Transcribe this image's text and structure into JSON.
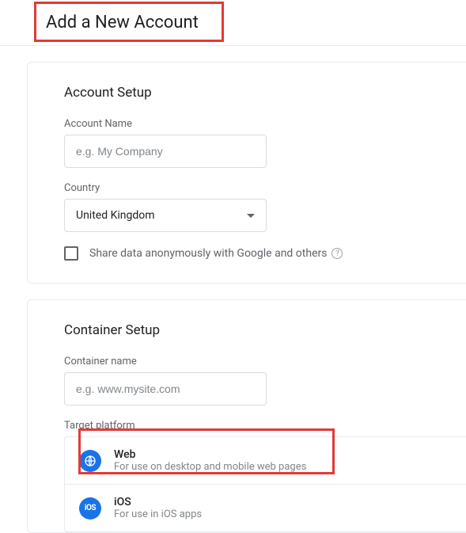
{
  "page": {
    "title": "Add a New Account"
  },
  "accountSetup": {
    "heading": "Account Setup",
    "nameLabel": "Account Name",
    "namePlaceholder": "e.g. My Company",
    "countryLabel": "Country",
    "countryValue": "United Kingdom",
    "shareCheckboxLabel": "Share data anonymously with Google and others",
    "shareChecked": false
  },
  "containerSetup": {
    "heading": "Container Setup",
    "nameLabel": "Container name",
    "namePlaceholder": "e.g. www.mysite.com",
    "platformLabel": "Target platform",
    "platforms": [
      {
        "title": "Web",
        "desc": "For use on desktop and mobile web pages",
        "icon": "web"
      },
      {
        "title": "iOS",
        "desc": "For use in iOS apps",
        "icon": "ios"
      }
    ]
  },
  "colors": {
    "highlight": "#e53935",
    "accent": "#1a73e8"
  }
}
